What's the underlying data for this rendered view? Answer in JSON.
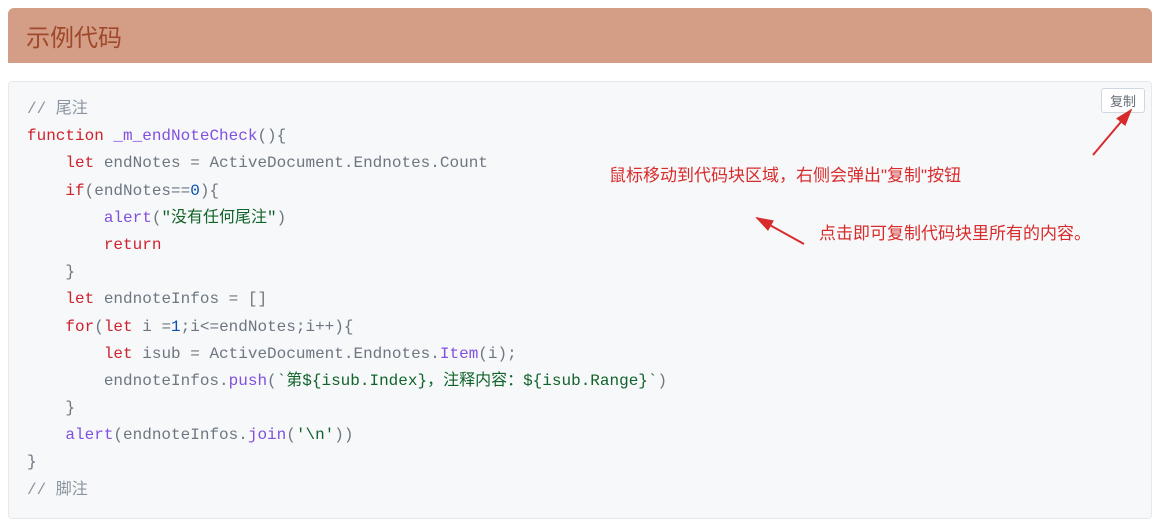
{
  "header": {
    "title": "示例代码"
  },
  "copy_button": {
    "label": "复制"
  },
  "annotations": {
    "line1": "鼠标移动到代码块区域，右侧会弹出\"复制\"按钮",
    "line2": "点击即可复制代码块里所有的内容。"
  },
  "code": {
    "cm_top": "// 尾注",
    "l_function": "function",
    "l_fnname": "_m_endNoteCheck",
    "l_fn_parens": "(){",
    "l_let": "let",
    "l_endNotes": "endNotes",
    "l_assign1_rhs": " = ActiveDocument.Endnotes.Count",
    "l_if": "if",
    "l_if_cond_open": "(endNotes==",
    "l_zero": "0",
    "l_if_cond_close": "){",
    "l_alert": "alert",
    "l_alert_open": "(",
    "l_str_no_endnote": "\"没有任何尾注\"",
    "l_alert_close": ")",
    "l_return": "return",
    "l_brace_close": "}",
    "l_endnoteInfos": "endnoteInfos",
    "l_eqempty": " = []",
    "l_for": "for",
    "l_for_open": "(",
    "l_for_let": "let",
    "l_for_i": " i =",
    "l_one": "1",
    "l_for_cond": ";i<=endNotes;i++){",
    "l_isub": "isub",
    "l_isub_rhs_pre": " = ActiveDocument.Endnotes.",
    "l_Item": "Item",
    "l_isub_arg": "(i);",
    "l_push": "push",
    "l_push_pre": "endnoteInfos.",
    "l_push_open": "(",
    "l_tmpl": "`第${isub.Index}，注释内容：${isub.Range}`",
    "l_push_close": ")",
    "l_alert2_arg_pre": "(endnoteInfos.",
    "l_join": "join",
    "l_join_open": "(",
    "l_join_str": "'\\n'",
    "l_join_close": "))",
    "cm_bottom": "// 脚注"
  }
}
